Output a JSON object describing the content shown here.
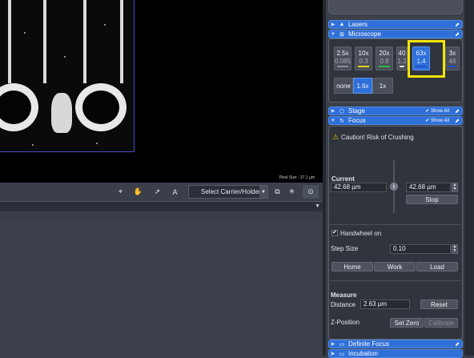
{
  "viewer": {
    "pixel_size": "Pixel Size : 37.1 µm"
  },
  "toolbar": {
    "crosshair_icon": "crosshair-icon",
    "hand_icon": "hand-icon",
    "pointer_icon": "pointer-icon",
    "text_tool_label": "A",
    "select_carrier_label": "Select Carrier/Holder",
    "camera_icon": "camera-icon"
  },
  "sections": {
    "lasers": "Lasers",
    "microscope": "Microscope",
    "stage": "Stage",
    "focus": "Focus",
    "definite_focus": "Definite Focus",
    "incubation": "Incubation",
    "show_all": "Show All"
  },
  "objectives": [
    {
      "mag": "2.5x",
      "na": "0.085",
      "color": "#8a8f98"
    },
    {
      "mag": "10x",
      "na": "0.3",
      "color": "#e8d022"
    },
    {
      "mag": "20x",
      "na": "0.8",
      "color": "#2fb24a"
    },
    {
      "mag": "40",
      "na": "1.2",
      "color": "#e0e0e0"
    },
    {
      "mag": "63x",
      "na": "1.4",
      "color": "#1f4fd0",
      "active": true
    },
    {
      "mag": "3x",
      "na": "46",
      "color": "#1f4fd0"
    }
  ],
  "tube_lens": [
    {
      "label": "none",
      "active": false
    },
    {
      "label": "1.6x",
      "active": true
    },
    {
      "label": "1x",
      "active": false
    }
  ],
  "focus": {
    "caution": "Caution! Risk of Crushing",
    "current_label": "Current",
    "current_value": "42.68 µm",
    "target_value": "42.68 µm",
    "stop_label": "Stop",
    "handwheel_label": "Handwheel on",
    "handwheel_checked": true,
    "step_size_label": "Step Size",
    "step_size_value": "0.10",
    "home_label": "Home",
    "work_label": "Work",
    "load_label": "Load",
    "measure_label": "Measure",
    "distance_label": "Distance",
    "distance_value": "2.63 µm",
    "reset_label": "Reset",
    "zpos_label": "Z-Position",
    "set_zero_label": "Set Zero",
    "calibrate_label": "Calibrate"
  },
  "colors": {
    "accent": "#2f6fd8",
    "highlight": "#f4e40b"
  }
}
